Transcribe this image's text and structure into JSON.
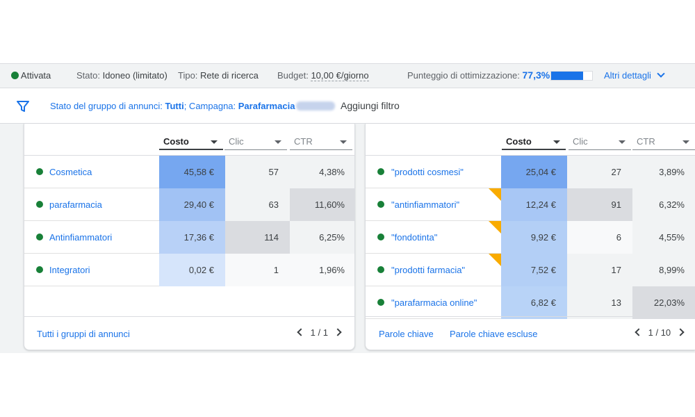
{
  "status_bar": {
    "status": "Attivata",
    "stato_label": "Stato:",
    "stato_value": "Idoneo (limitato)",
    "tipo_label": "Tipo:",
    "tipo_value": "Rete di ricerca",
    "budget_label": "Budget:",
    "budget_value": "10,00 €/giorno",
    "optimization_label": "Punteggio di ottimizzazione:",
    "optimization_value": "77,3%",
    "optimization_fraction": 0.773,
    "more_details": "Altri dettagli"
  },
  "filter_bar": {
    "prefix": "Stato del gruppo di annunci: ",
    "group_value": "Tutti",
    "sep": "; Campagna: ",
    "campaign_value": "Parafarmacia",
    "add_filter": "Aggiungi filtro"
  },
  "left_table": {
    "columns": [
      "Costo",
      "Clic",
      "CTR"
    ],
    "rows": [
      {
        "name": "Cosmetica",
        "cost": "45,58 €",
        "clicks": "57",
        "ctr": "4,38%"
      },
      {
        "name": "parafarmacia",
        "cost": "29,40 €",
        "clicks": "63",
        "ctr": "11,60%"
      },
      {
        "name": "Antinfiammatori",
        "cost": "17,36 €",
        "clicks": "114",
        "ctr": "6,25%"
      },
      {
        "name": "Integratori",
        "cost": "0,02 €",
        "clicks": "1",
        "ctr": "1,96%"
      }
    ],
    "footer_link": "Tutti i gruppi di annunci",
    "pager": "1 / 1"
  },
  "right_table": {
    "columns": [
      "Costo",
      "Clic",
      "CTR"
    ],
    "rows": [
      {
        "name": "\"prodotti cosmesi\"",
        "cost": "25,04 €",
        "clicks": "27",
        "ctr": "3,89%"
      },
      {
        "name": "\"antinfiammatori\"",
        "cost": "12,24 €",
        "clicks": "91",
        "ctr": "6,32%"
      },
      {
        "name": "\"fondotinta\"",
        "cost": "9,92 €",
        "clicks": "6",
        "ctr": "4,55%"
      },
      {
        "name": "\"prodotti farmacia\"",
        "cost": "7,52 €",
        "clicks": "17",
        "ctr": "8,99%"
      },
      {
        "name": "\"parafarmacia online\"",
        "cost": "6,82 €",
        "clicks": "13",
        "ctr": "22,03%"
      }
    ],
    "footer_link_1": "Parole chiave",
    "footer_link_2": "Parole chiave escluse",
    "pager": "1 / 10"
  },
  "colors": {
    "accent": "#1a73e8",
    "status_green": "#188038",
    "flag_yellow": "#f9ab00"
  }
}
